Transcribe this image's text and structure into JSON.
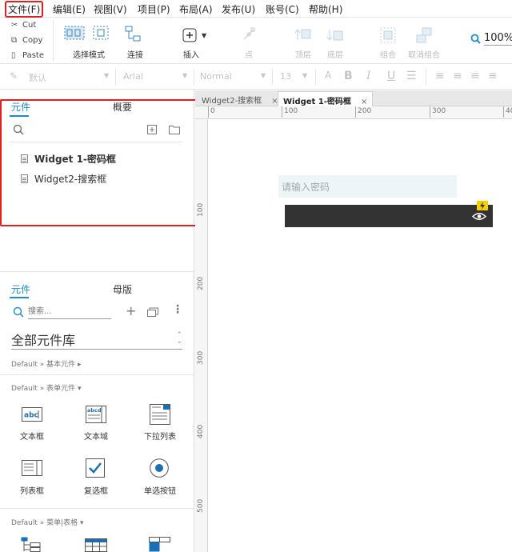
{
  "menu": {
    "items": [
      "文件(F)",
      "编辑(E)",
      "视图(V)",
      "项目(P)",
      "布局(A)",
      "发布(U)",
      "账号(C)",
      "帮助(H)"
    ]
  },
  "toolbar": {
    "cut": "Cut",
    "copy": "Copy",
    "paste": "Paste",
    "select_mode": "选择模式",
    "connect": "连接",
    "insert": "插入",
    "point": "点",
    "top": "顶层",
    "bottom": "底层",
    "group": "组合",
    "ungroup": "取消组合",
    "zoom": "100%"
  },
  "formatbar": {
    "style": "默认",
    "font": "Arial",
    "weight": "Normal",
    "size": "13"
  },
  "pages_panel": {
    "tab_pages": "元件",
    "tab_outline": "概要",
    "pages": [
      "Widget 1-密码框",
      "Widget2-搜索框"
    ]
  },
  "library_panel": {
    "tab_widgets": "元件",
    "tab_masters": "母版",
    "search_placeholder": "搜索...",
    "library_name": "全部元件库",
    "sections": [
      "Default » 基本元件 ▸",
      "Default » 表单元件 ▾",
      "Default » 菜单|表格 ▾"
    ],
    "widgets": [
      "文本框",
      "文本域",
      "下拉列表",
      "列表框",
      "复选框",
      "单选按钮"
    ]
  },
  "doc_tabs": [
    {
      "label": "Widget2-搜索框",
      "active": false
    },
    {
      "label": "Widget 1-密码框",
      "active": true
    }
  ],
  "ruler": {
    "top": [
      "0",
      "100",
      "200",
      "300",
      "40"
    ],
    "left": [
      "100",
      "200",
      "300",
      "400",
      "500"
    ]
  },
  "canvas": {
    "password_placeholder": "请输入密码"
  },
  "colors": {
    "accent": "#1a8cd8",
    "highlight": "#e02020",
    "dark_bar": "#333333",
    "badge": "#f5d000"
  }
}
